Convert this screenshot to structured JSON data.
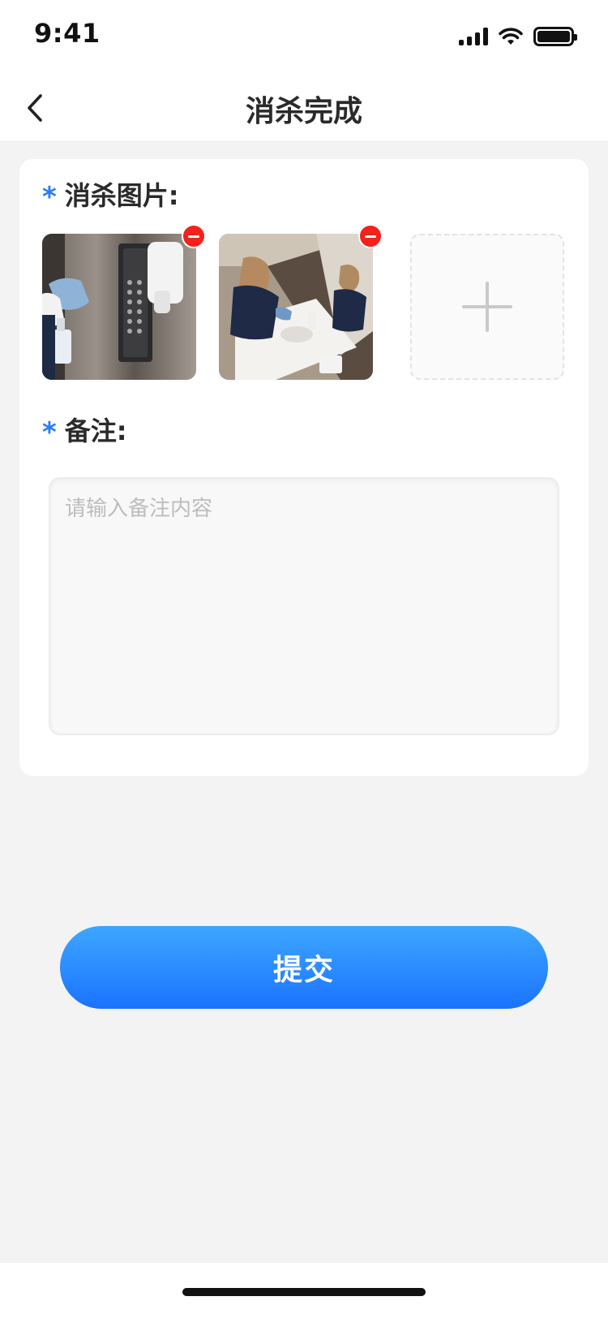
{
  "status_bar": {
    "time": "9:41",
    "icons": [
      "signal-icon",
      "wifi-icon",
      "battery-icon"
    ]
  },
  "nav": {
    "title": "消杀完成",
    "back_icon": "chevron-left-icon"
  },
  "form": {
    "photos": {
      "required_mark": "*",
      "label": "消杀图片:",
      "images": [
        {
          "name": "photo-elevator-panel-cleaning",
          "remove_icon": "remove-icon"
        },
        {
          "name": "photo-sink-cleaning",
          "remove_icon": "remove-icon"
        }
      ],
      "add_icon": "plus-icon"
    },
    "note": {
      "required_mark": "*",
      "label": "备注:",
      "value": "",
      "placeholder": "请输入备注内容"
    }
  },
  "submit": {
    "label": "提交"
  },
  "colors": {
    "accent": "#2a7cf6",
    "button_top": "#3ea6ff",
    "button_bottom": "#1a73ff",
    "remove": "#f5211c",
    "background": "#f3f3f3"
  }
}
